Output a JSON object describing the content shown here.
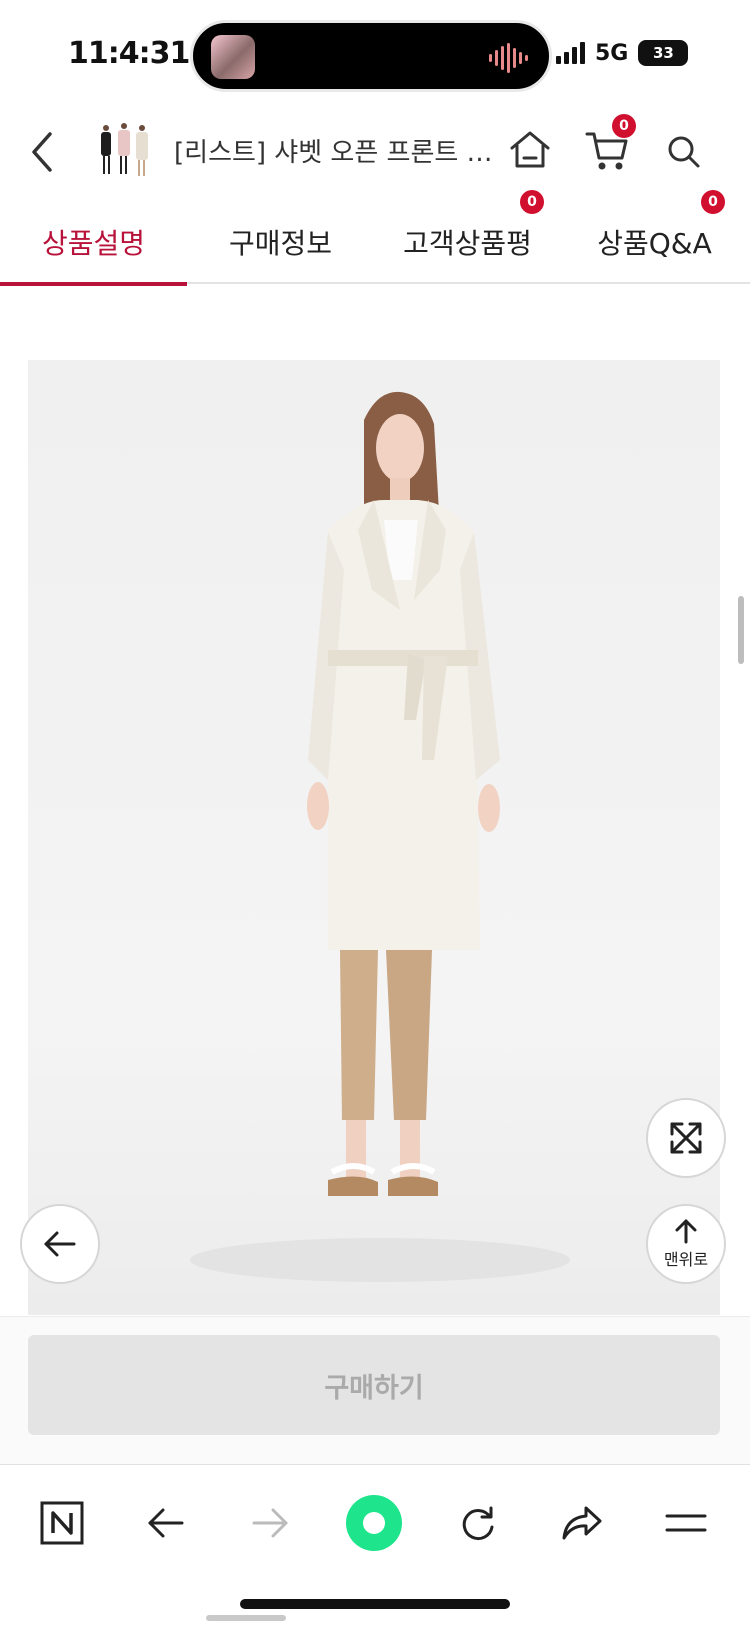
{
  "status_bar": {
    "time": "11:4:31",
    "network": "5G",
    "battery": "33"
  },
  "header": {
    "title": "[리스트] 샤벳 오픈 프론트 트렌치코트",
    "cart_count": "0",
    "icons": [
      "back-icon",
      "home-icon",
      "cart-icon",
      "search-icon"
    ]
  },
  "tabs": [
    {
      "label": "상품설명",
      "active": true
    },
    {
      "label": "구매정보",
      "active": false
    },
    {
      "label": "고객상품평",
      "badge": "0"
    },
    {
      "label": "상품Q&A",
      "badge": "0"
    }
  ],
  "floating": {
    "scroll_top_label": "맨위로",
    "expand_icon": "expand-icon",
    "back_icon": "arrow-left-icon"
  },
  "buy": {
    "label": "구매하기"
  },
  "browser_toolbar": {
    "icons": [
      "naver-n-icon",
      "arrow-left-icon",
      "arrow-right-icon",
      "green-circle-icon",
      "refresh-icon",
      "share-icon",
      "menu-icon"
    ]
  },
  "colors": {
    "accent": "#b8123a",
    "badge": "#d0102e",
    "green": "#1ee58c"
  }
}
